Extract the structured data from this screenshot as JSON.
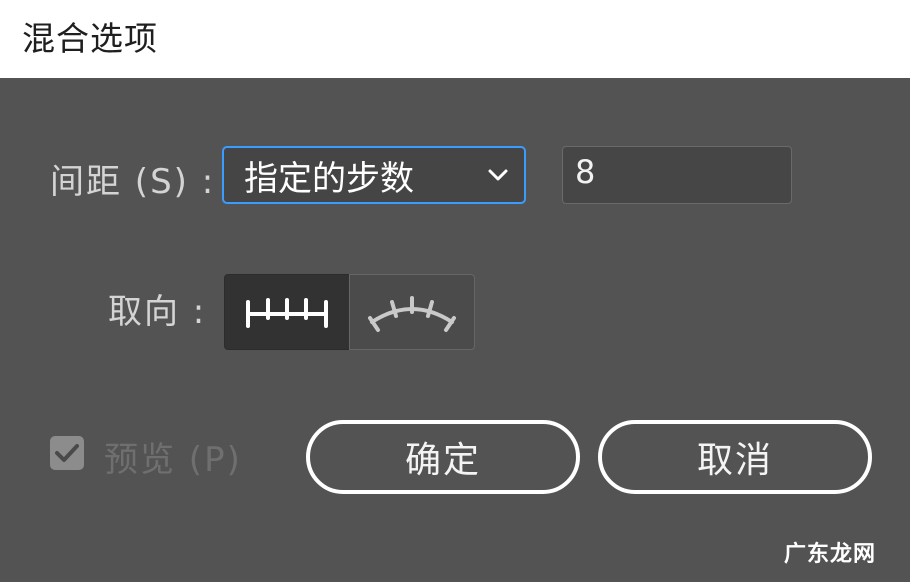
{
  "dialog": {
    "title": "混合选项"
  },
  "spacing": {
    "label": "间距 (S) :",
    "mode_value": "指定的步数",
    "steps_value": "8"
  },
  "orientation": {
    "label": "取向 :",
    "options": [
      {
        "icon": "align-to-page-icon",
        "selected": true
      },
      {
        "icon": "align-to-path-icon",
        "selected": false
      }
    ]
  },
  "preview": {
    "label": "预览 (P)",
    "checked": true,
    "disabled": true
  },
  "buttons": {
    "ok_label": "确定",
    "cancel_label": "取消"
  },
  "watermark": "广东龙网",
  "colors": {
    "dialog_bg": "#535353",
    "focus_border": "#3b9cff",
    "button_border": "#ffffff"
  }
}
